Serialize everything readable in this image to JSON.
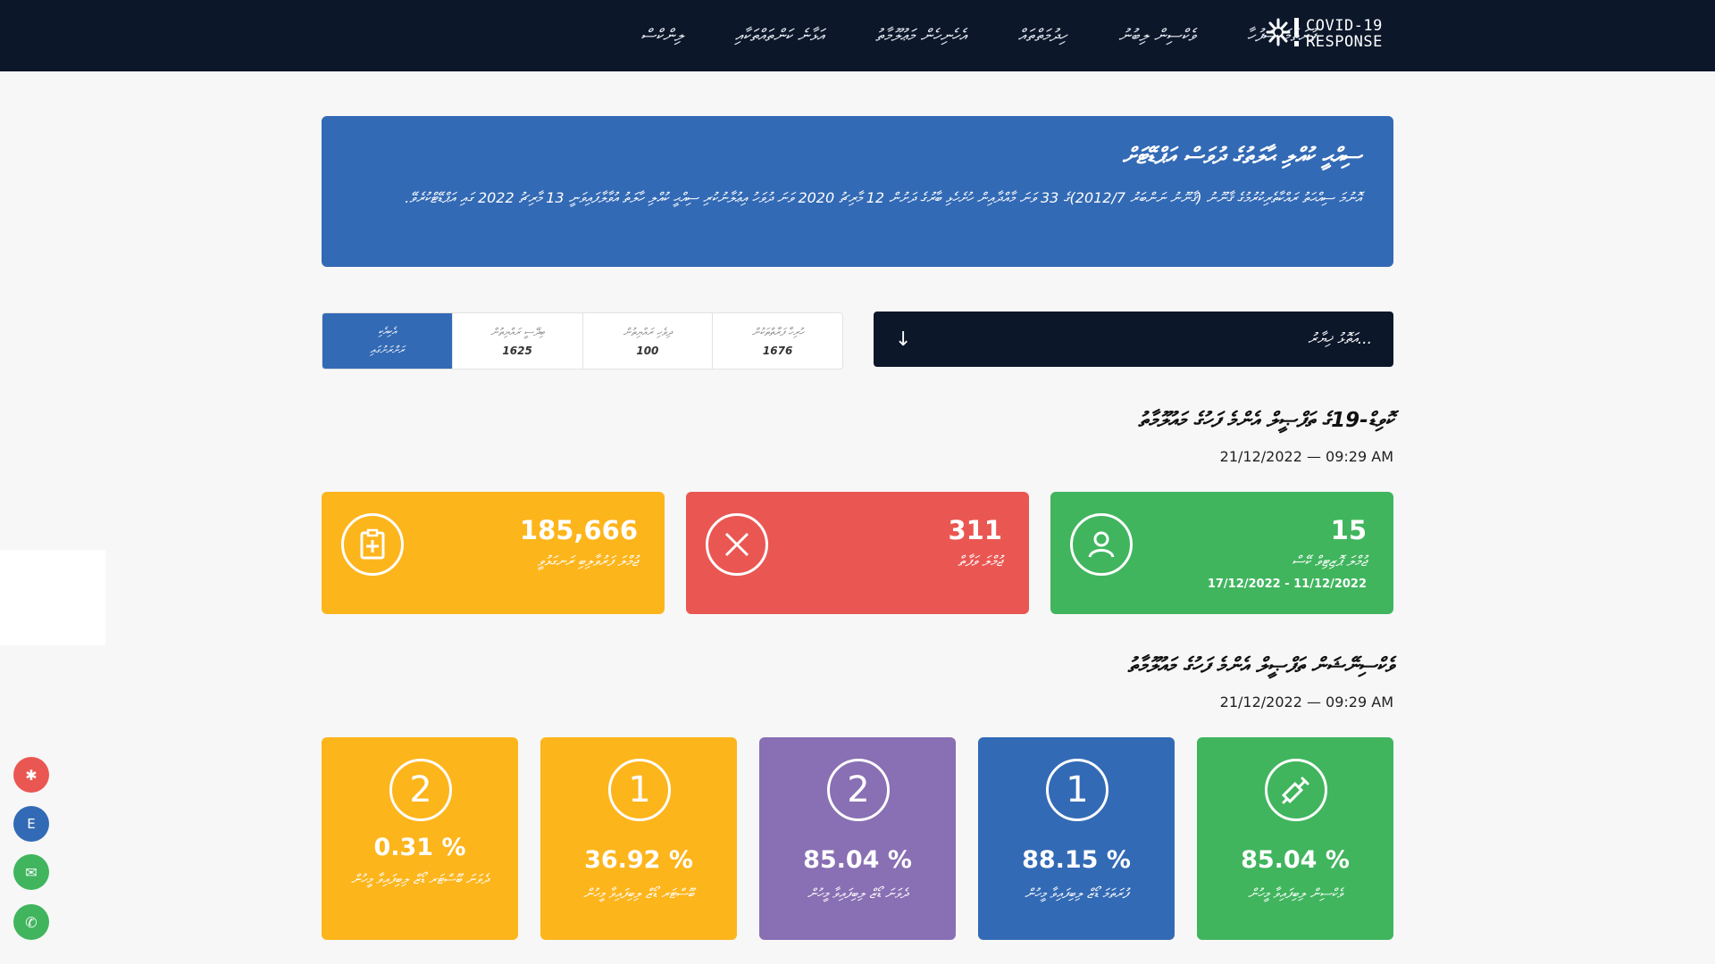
{
  "header": {
    "brand_line1": "COVID-19",
    "brand_line2": "RESPONSE",
    "nav": [
      "ފުރަތަމަ ސަފުހާ",
      "ވެކްސިން ލިބުނު",
      "ހިދުމަތްތައް",
      "އެހެނިހެން މަޢުލޫމާތު",
      "އަޅާނެ ކަންތައްތަކާއި",
      "ލިންކްސް"
    ]
  },
  "banner": {
    "title": "ސިއްޙީ ކުއްލި ޙާލަތުގެ ދުވަސް އަޕްޑޭޓަށް",
    "text": "އޮނުމަ ސިއްޙަތު ރައްކާތެރިކުރުމުގެ ޤާނޫނު (ޤާނޫނު ނަންބަރު 2012/7)ގެ 33 ވަނަ މާއްދާއިން ހުށެހެޅި ބާރުގެ ދަށުން 12 މާރިޗު 2020 ވަނަ ދުވަހު އިޢުލާނުކުރި ސިއްޙީ ކުއްލި ހާލަތު އުވާލާފައިވަނީ 13 މާރިޗު 2022 ގައި އަޕްޑޭޓްކުރެވޭ."
  },
  "tabs": [
    {
      "label": "ހުރިހާ ފަރާތްތަކުން",
      "value": "1676"
    },
    {
      "label": "ދިވެހި ރައްޔިތުން",
      "value": "100"
    },
    {
      "label": "ބިދޭސީ ރައްޔިތުން",
      "value": "1625"
    },
    {
      "label": "އެކިއެކި",
      "label2": "ރަށްރަށުގައި",
      "value": ""
    }
  ],
  "island_select": {
    "label": "އަތޮޅު ޚިޔާރު...",
    "arrow": "↓"
  },
  "cases": {
    "title": "ކޮވިޑް-19ގެ ތަފްޞީލް އެންމެ ފަހުގެ މައުލޫމާތު",
    "date": "21/12/2022 — 09:29 AM",
    "cards": [
      {
        "value": "15",
        "label": "ޖުމްލަ ޕޮޒިޓިވް ކޭސް",
        "sub": "17/12/2022 - 11/12/2022",
        "color": "#40b55e",
        "icon": "person-icon"
      },
      {
        "value": "311",
        "label": "ޖުމްލަ ވަފާތް",
        "sub": "",
        "color": "#ea5752",
        "icon": "close-circle-icon"
      },
      {
        "value": "185,666",
        "label": "ޖުމްލަ ފަރުވާލިބި ރަނގަޅުވީ",
        "sub": "",
        "color": "#fdb51c",
        "icon": "clipboard-plus-icon"
      }
    ]
  },
  "vaccine": {
    "title": "ވެކްސިނޭޝަން ތަފްޞީލް އެންމެ ފަހުގެ މައުލޫމާތު",
    "date": "21/12/2022 — 09:29 AM",
    "cards": [
      {
        "badge": "",
        "pct": "85.04 %",
        "label": "ވެކްސިން ލިބިފައިވާ މީހުން",
        "color": "#40b55e",
        "icon": "syringe-icon"
      },
      {
        "badge": "1",
        "pct": "88.15 %",
        "label": "ފުރަތަމަ ޑޯޒް ލިބިފައިވާ މީހުން",
        "color": "#336ab5",
        "icon": "dose-1-icon"
      },
      {
        "badge": "2",
        "pct": "85.04 %",
        "label": "ދެވަނަ ޑޯޒް ލިބިފައިވާ މީހުން",
        "color": "#896fb3",
        "icon": "dose-2-icon"
      },
      {
        "badge": "1",
        "pct": "36.92 %",
        "label": "ބޫސްޓަރ ޑޯޒް ލިބިފައިވާ މީހުން",
        "color": "#fdb51c",
        "icon": "booster-1-icon"
      },
      {
        "badge": "2",
        "pct": "0.31 %",
        "label": "ދެވަނަ ބޫސްޓަރ ޑޯޒް ލިބިފައިވާ މީހުން",
        "color": "#fdb51c",
        "icon": "booster-2-icon"
      }
    ]
  },
  "floating": [
    {
      "glyph": "✱",
      "color": "#ea5752",
      "icon": "virus-icon"
    },
    {
      "glyph": "E",
      "color": "#336ab5",
      "icon": "language-e-icon"
    },
    {
      "glyph": "✉",
      "color": "#40b55e",
      "icon": "mail-icon"
    },
    {
      "glyph": "✆",
      "color": "#40b55e",
      "icon": "phone-icon"
    }
  ]
}
